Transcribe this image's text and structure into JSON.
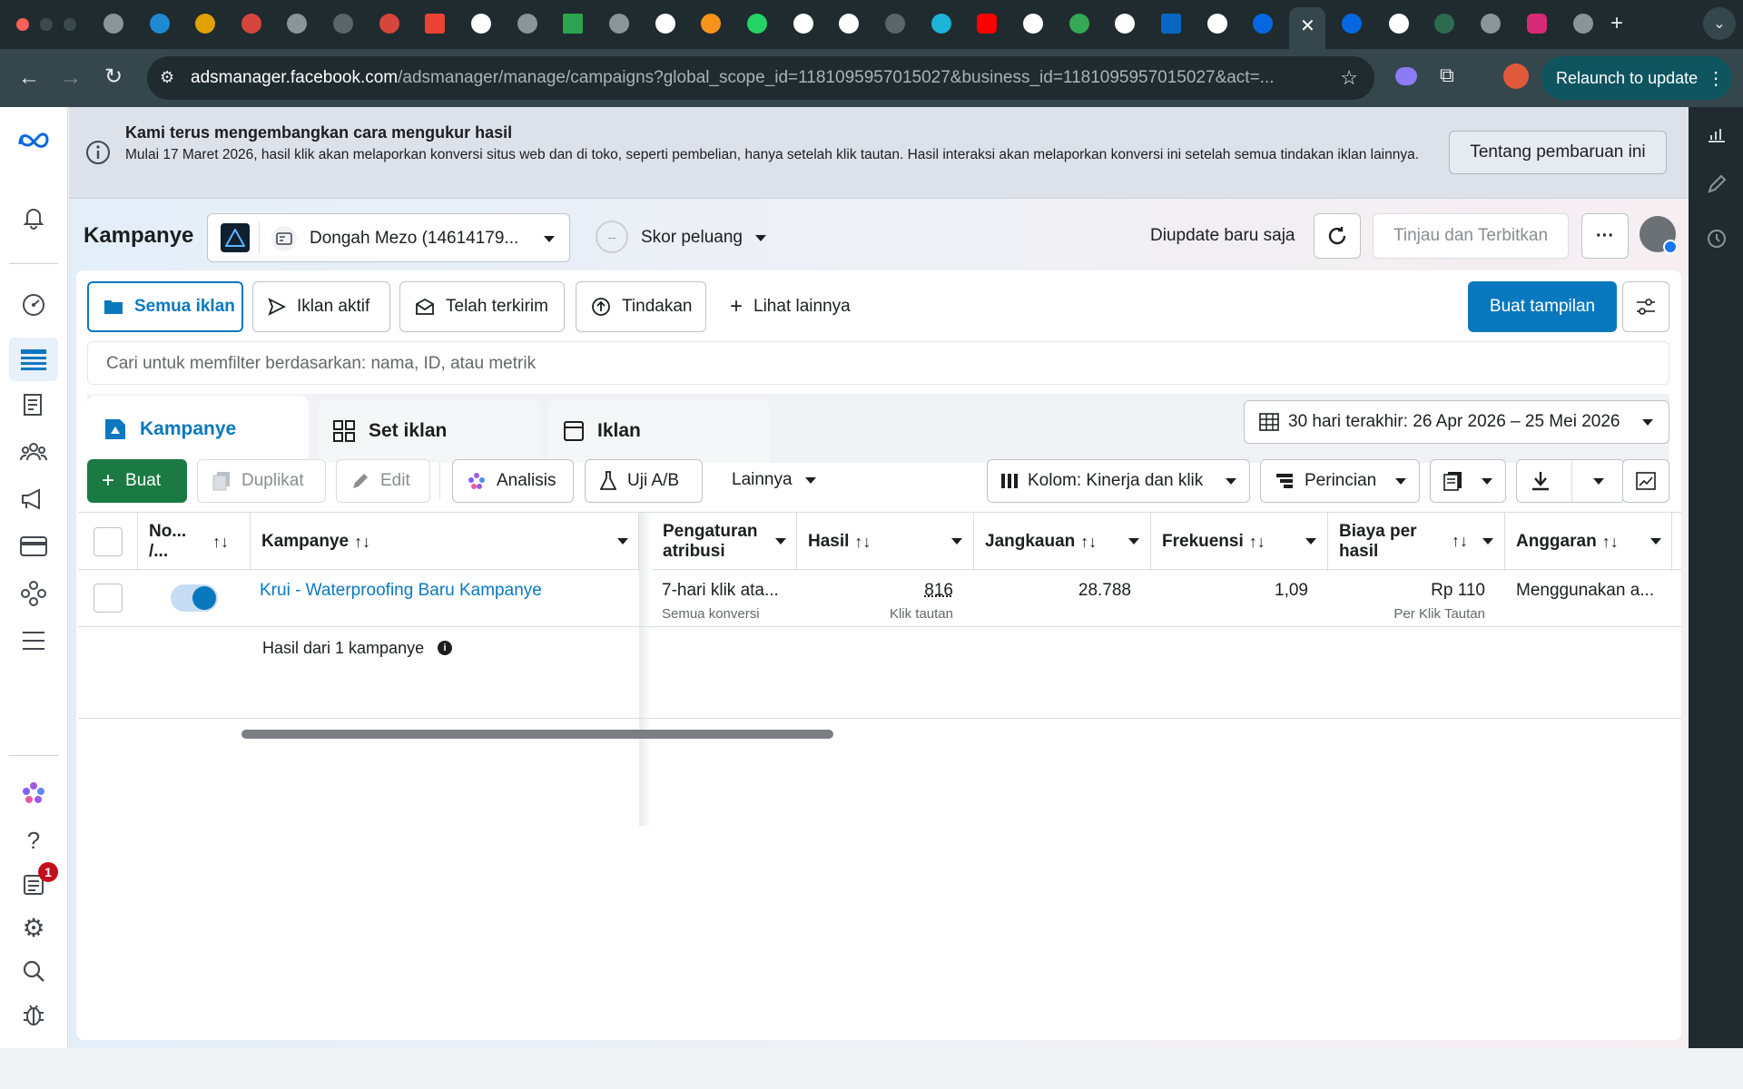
{
  "browser": {
    "url_host": "adsmanager.facebook.com",
    "url_rest": "/adsmanager/manage/campaigns?global_scope_id=1181095957015027&business_id=1181095957015027&act=...",
    "relaunch_label": "Relaunch to update"
  },
  "banner": {
    "title": "Kami terus mengembangkan cara mengukur hasil",
    "body": "Mulai 17 Maret 2026, hasil klik akan melaporkan konversi situs web dan di toko, seperti pembelian, hanya setelah klik tautan. Hasil interaksi akan melaporkan konversi ini setelah semua tindakan iklan lainnya.",
    "button": "Tentang pembaruan ini"
  },
  "header": {
    "title": "Kampanye",
    "account": "Dongah Mezo (14614179...",
    "score_dash": "--",
    "score_label": "Skor peluang",
    "updated": "Diupdate baru saja",
    "review_publish": "Tinjau dan Terbitkan",
    "more": "···"
  },
  "filters": {
    "tabs": [
      "Semua iklan",
      "Iklan aktif",
      "Telah terkirim",
      "Tindakan"
    ],
    "see_more": "Lihat lainnya",
    "create_view": "Buat tampilan",
    "search_placeholder": "Cari untuk memfilter berdasarkan: nama, ID, atau metrik"
  },
  "levels": {
    "campaigns": "Kampanye",
    "adsets": "Set iklan",
    "ads": "Iklan",
    "date_range": "30 hari terakhir: 26 Apr 2026 – 25 Mei 2026"
  },
  "actions": {
    "create": "Buat",
    "duplicate": "Duplikat",
    "edit": "Edit",
    "analysis": "Analisis",
    "ab_test": "Uji A/B",
    "more": "Lainnya",
    "columns": "Kolom: Kinerja dan klik",
    "breakdown": "Perincian"
  },
  "table": {
    "headers": {
      "onoff": "No... /...",
      "campaign": "Kampanye",
      "attribution": "Pengaturan atribusi",
      "results": "Hasil",
      "reach": "Jangkauan",
      "frequency": "Frekuensi",
      "cost_per_result": "Biaya per hasil",
      "budget": "Anggaran"
    },
    "row": {
      "name": "Krui - Waterproofing Baru Kampanye",
      "attribution": "7-hari klik ata...",
      "attribution_sub": "Semua konversi",
      "results": "816",
      "results_sub": "Klik tautan",
      "reach": "28.788",
      "frequency": "1,09",
      "cpr": "Rp 110",
      "cpr_sub": "Per Klik Tautan",
      "budget": "Menggunakan a..."
    },
    "summary": "Hasil dari 1 kampanye"
  },
  "notifications": {
    "badge": "1"
  },
  "colors": {
    "primary": "#0a78be",
    "create_green": "#1b7a44",
    "link": "#1877f2"
  }
}
